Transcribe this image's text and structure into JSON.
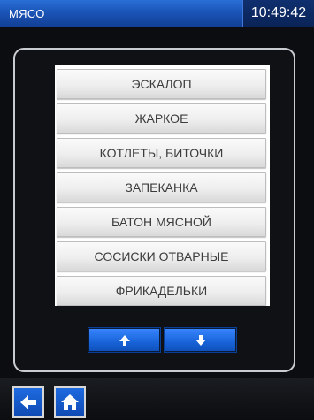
{
  "header": {
    "title": "МЯСО",
    "time": "10:49:42"
  },
  "menu": {
    "items": [
      "ЭСКАЛОП",
      "ЖАРКОЕ",
      "КОТЛЕТЫ, БИТОЧКИ",
      "ЗАПЕКАНКА",
      "БАТОН МЯСНОЙ",
      "СОСИСКИ ОТВАРНЫЕ",
      "ФРИКАДЕЛЬКИ"
    ]
  },
  "controls": {
    "scroll_up_icon": "arrow-up-icon",
    "scroll_down_icon": "arrow-down-icon"
  },
  "footer": {
    "back_icon": "arrow-left-icon",
    "home_icon": "home-icon"
  },
  "colors": {
    "accent_blue": "#1b55b8",
    "background": "#0b0d10"
  }
}
